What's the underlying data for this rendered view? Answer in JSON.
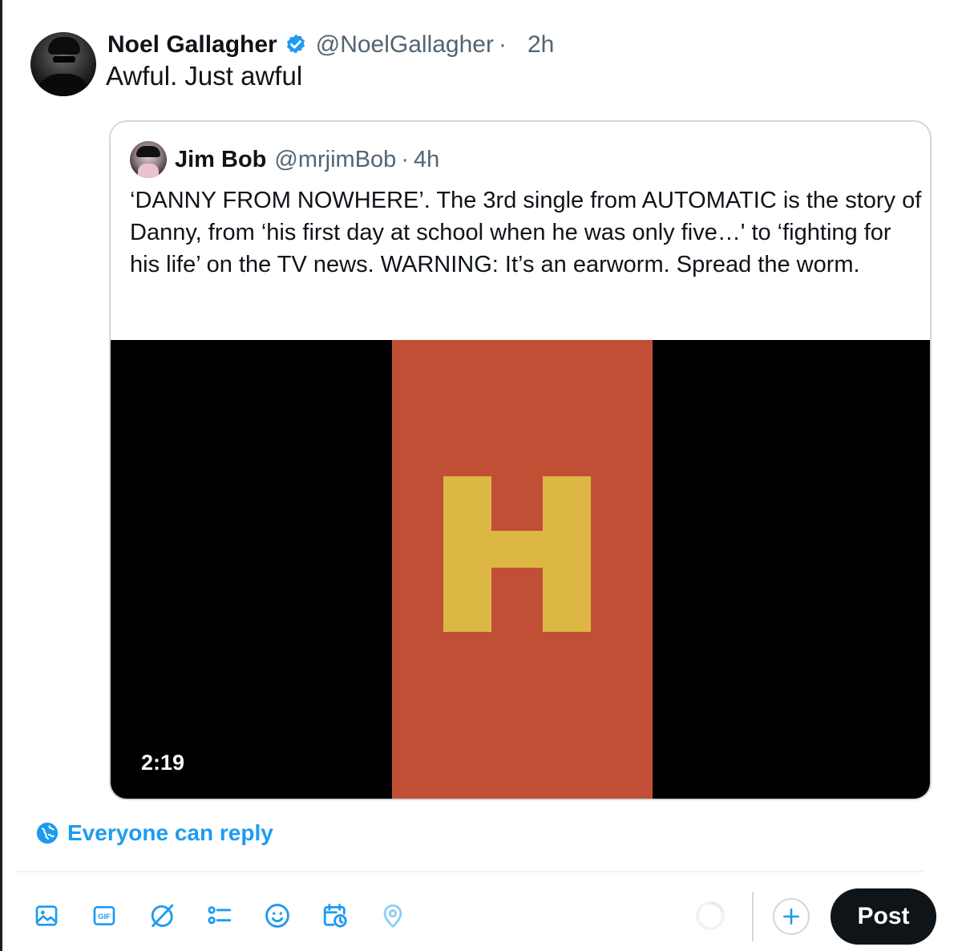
{
  "tweet": {
    "display_name": "Noel Gallagher",
    "handle": "@NoelGallagher",
    "separator": "·",
    "time": "2h",
    "text": "Awful. Just awful",
    "verified_icon": "verified-badge-icon"
  },
  "quoted_tweet": {
    "display_name": "Jim Bob",
    "handle": "@mrjimBob",
    "separator": "·",
    "time": "4h",
    "text": "‘DANNY FROM NOWHERE’. The 3rd single from AUTOMATIC is the story of Danny, from ‘his first day at school when he was only five…' to ‘fighting for his life’ on the TV news. WARNING: It’s an earworm. Spread the worm.",
    "video": {
      "duration": "2:19",
      "letter": "H",
      "colors": {
        "background": "#000000",
        "panel": "#c14f35",
        "letter": "#ddb744"
      }
    }
  },
  "reply_setting": {
    "label": "Everyone can reply",
    "icon": "globe-icon"
  },
  "composer_toolbar": {
    "icons": [
      "image-icon",
      "gif-icon",
      "grok-icon",
      "poll-icon",
      "emoji-icon",
      "schedule-icon",
      "location-icon"
    ],
    "gif_label": "GIF",
    "char_counter_icon": "progress-ring-icon",
    "add_icon": "plus-icon",
    "post_label": "Post"
  },
  "colors": {
    "accent": "#1d9bf0",
    "text": "#0f1419",
    "secondary_text": "#536471",
    "border": "#cfd9de",
    "post_button": "#0f1419"
  }
}
